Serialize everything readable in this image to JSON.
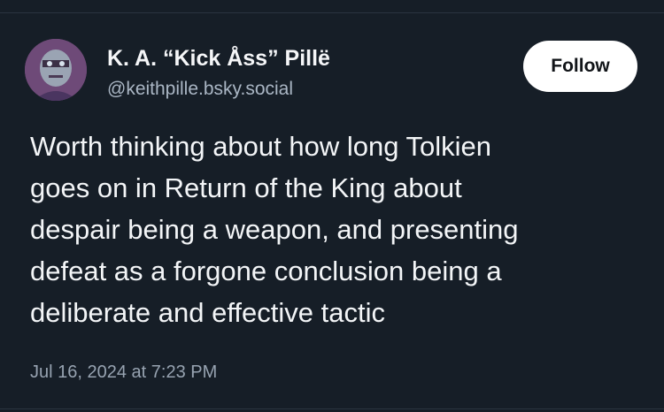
{
  "post": {
    "author": {
      "display_name": "K. A. “Kick Åss” Pillë",
      "handle": "@keithpille.bsky.social",
      "avatar_icon": "avatar-portrait-icon"
    },
    "follow_label": "Follow",
    "text_lines": [
      "Worth thinking about how long Tolkien",
      "goes on in Return of the King about",
      "despair being a weapon, and presenting",
      "defeat as a forgone conclusion being a",
      "deliberate and effective tactic"
    ],
    "timestamp": "Jul 16, 2024 at 7:23 PM"
  },
  "colors": {
    "background": "#161e27",
    "text": "#f3f5f7",
    "muted": "#aab6c4",
    "button_bg": "#ffffff"
  }
}
